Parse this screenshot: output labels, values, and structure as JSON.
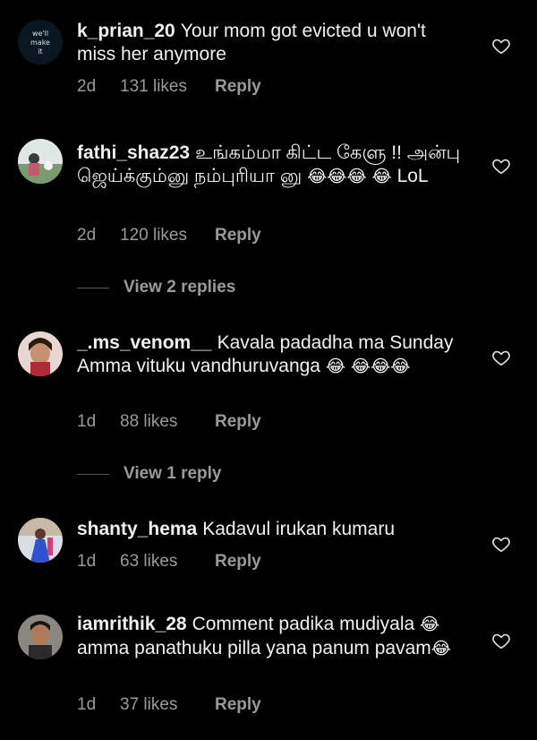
{
  "colors": {
    "background": "#000000",
    "text": "#f0f0f0",
    "meta": "#9a9a9a"
  },
  "comments": [
    {
      "username": "k_prian_20",
      "text": "Your mom got evicted u won't miss her anymore",
      "time": "2d",
      "likes": "131 likes",
      "reply": "Reply",
      "avatar_icon": "neon-text-avatar"
    },
    {
      "username": "fathi_shaz23",
      "text": "உங்கம்மா கிட்ட கேளு !! அன்பு ஜெய்க்கும்னு நம்புரியா னு",
      "text_tail": "LoL",
      "time": "2d",
      "likes": "120 likes",
      "reply": "Reply",
      "view_replies": "View 2 replies",
      "avatar_icon": "photo-avatar"
    },
    {
      "username": "_.ms_venom__",
      "text": "Kavala padadha ma Sunday Amma vituku vandhuruvanga",
      "time": "1d",
      "likes": "88 likes",
      "reply": "Reply",
      "view_replies": "View 1 reply",
      "avatar_icon": "photo-avatar"
    },
    {
      "username": "shanty_hema",
      "text": "Kadavul irukan kumaru",
      "time": "1d",
      "likes": "63 likes",
      "reply": "Reply",
      "avatar_icon": "photo-avatar"
    },
    {
      "username": "iamrithik_28",
      "text": "Comment padika mudiyala",
      "text_mid": "amma panathuku pilla yana panum",
      "text_tail": "pavam",
      "time": "1d",
      "likes": "37 likes",
      "reply": "Reply",
      "avatar_icon": "photo-avatar"
    }
  ],
  "emoji": "😂",
  "heart_icon": "heart-outline-icon"
}
